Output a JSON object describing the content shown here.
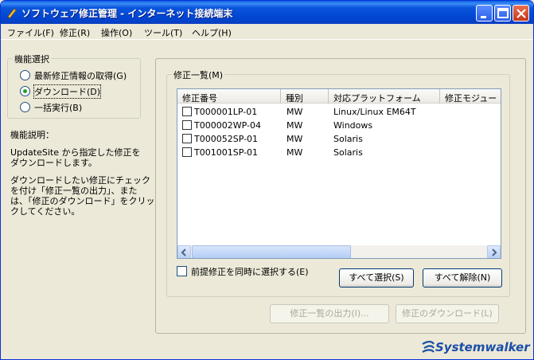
{
  "window": {
    "title": "ソフトウェア修正管理 - インターネット接続端末"
  },
  "menu": [
    "ファイル(F)",
    "修正(R)",
    "操作(O)",
    "ツール(T)",
    "ヘルプ(H)"
  ],
  "function_select": {
    "label": "機能選択",
    "options": [
      {
        "label": "最新修正情報の取得(G)",
        "selected": false
      },
      {
        "label": "ダウンロード(D)",
        "selected": true
      },
      {
        "label": "一括実行(B)",
        "selected": false
      }
    ]
  },
  "description": {
    "title": "機能説明：",
    "lines": [
      "UpdateSite から指定した修正を",
      "ダウンロードします。",
      "",
      "ダウンロードしたい修正にチェック",
      "を付け「修正一覧の出力」、また",
      "は、「修正のダウンロード」をクリッ",
      "クしてください。"
    ]
  },
  "fix_list": {
    "label": "修正一覧(M)",
    "columns": [
      "修正番号",
      "種別",
      "対応プラットフォーム",
      "修正モジュー"
    ],
    "rows": [
      [
        "T000001LP-01",
        "MW",
        "Linux/Linux EM64T"
      ],
      [
        "T000002WP-04",
        "MW",
        "Windows"
      ],
      [
        "T000052SP-01",
        "MW",
        "Solaris"
      ],
      [
        "T001001SP-01",
        "MW",
        "Solaris"
      ]
    ]
  },
  "prereq_checkbox": "前提修正を同時に選択する(E)",
  "buttons": {
    "select_all": "すべて選択(S)",
    "deselect_all": "すべて解除(N)",
    "output_list": "修正一覧の出力(I)...",
    "download": "修正のダウンロード(L)"
  },
  "brand": "Systemwalker",
  "colors": {
    "titlebar": "#0a55dc",
    "brand": "#1b4fa8",
    "radio_dot": "#21a121"
  }
}
